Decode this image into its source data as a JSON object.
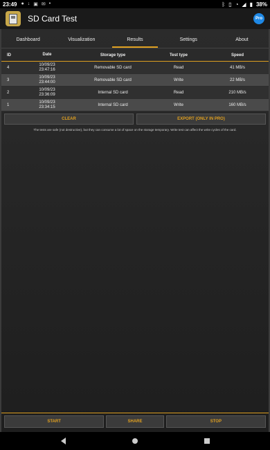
{
  "status_bar": {
    "time": "23:49",
    "battery": "38%",
    "left_icons": [
      "notification-icon",
      "download-icon",
      "gallery-icon",
      "mail-icon",
      "dot-icon"
    ],
    "right_icons": [
      "bluetooth-icon",
      "vibrate-icon",
      "wifi-icon",
      "signal-icon",
      "battery-icon"
    ]
  },
  "app": {
    "title": "SD Card Test",
    "pro_badge": "Pro"
  },
  "tabs": [
    {
      "label": "Dashboard"
    },
    {
      "label": "Visualization"
    },
    {
      "label": "Results",
      "active": true
    },
    {
      "label": "Settings"
    },
    {
      "label": "About"
    }
  ],
  "table": {
    "headers": {
      "id": "ID",
      "date": "Date",
      "storage": "Storage type",
      "test": "Test type",
      "speed": "Speed"
    },
    "rows": [
      {
        "id": "4",
        "date_day": "10/09/23",
        "date_time": "23:47:16",
        "storage": "Removable SD card",
        "test": "Read",
        "speed": "41 MB/s"
      },
      {
        "id": "3",
        "date_day": "10/09/23",
        "date_time": "23:44:00",
        "storage": "Removable SD card",
        "test": "Write",
        "speed": "22 MB/s"
      },
      {
        "id": "2",
        "date_day": "10/09/23",
        "date_time": "23:36:09",
        "storage": "Internal SD card",
        "test": "Read",
        "speed": "210 MB/s"
      },
      {
        "id": "1",
        "date_day": "10/09/23",
        "date_time": "23:34:15",
        "storage": "Internal SD card",
        "test": "Write",
        "speed": "160 MB/s"
      }
    ]
  },
  "actions": {
    "clear": "CLEAR",
    "export": "EXPORT (ONLY IN PRO)"
  },
  "note": "The tests are safe (not destructive), but they can consume a lot of space on the storage temporary. Write test can affect the write cycles of the card.",
  "bottom": {
    "start": "START",
    "share": "SHARE",
    "stop": "STOP"
  },
  "colors": {
    "accent": "#e0a020",
    "pro": "#1e88e5",
    "app_icon": "#c8a84a"
  }
}
